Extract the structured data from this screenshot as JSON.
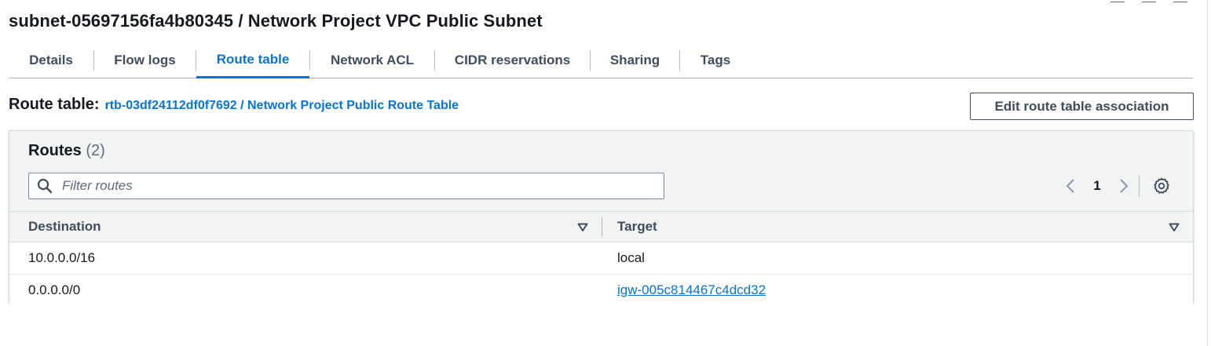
{
  "page": {
    "title": "subnet-05697156fa4b80345 / Network Project VPC Public Subnet"
  },
  "tabs": [
    {
      "label": "Details",
      "active": false
    },
    {
      "label": "Flow logs",
      "active": false
    },
    {
      "label": "Route table",
      "active": true
    },
    {
      "label": "Network ACL",
      "active": false
    },
    {
      "label": "CIDR reservations",
      "active": false
    },
    {
      "label": "Sharing",
      "active": false
    },
    {
      "label": "Tags",
      "active": false
    }
  ],
  "route_table": {
    "label": "Route table:",
    "link_text": "rtb-03df24112df0f7692 / Network Project Public Route Table",
    "edit_button": "Edit route table association"
  },
  "routes": {
    "title": "Routes",
    "count": "(2)",
    "filter_placeholder": "Filter routes",
    "filter_value": "",
    "page_number": "1",
    "columns": [
      "Destination",
      "Target"
    ],
    "rows": [
      {
        "destination": "10.0.0.0/16",
        "target": "local",
        "target_is_link": false
      },
      {
        "destination": "0.0.0.0/0",
        "target": "igw-005c814467c4dcd32",
        "target_is_link": true
      }
    ]
  },
  "icons": {
    "search": "search-icon",
    "prev": "chevron-left-icon",
    "next": "chevron-right-icon",
    "settings": "gear-icon",
    "sort": "caret-down-icon"
  },
  "colors": {
    "link": "#0972d3",
    "text": "#16191f",
    "secondary_text": "#414d5c",
    "panel_bg": "#f2f3f3",
    "border": "#d5dbdb"
  }
}
